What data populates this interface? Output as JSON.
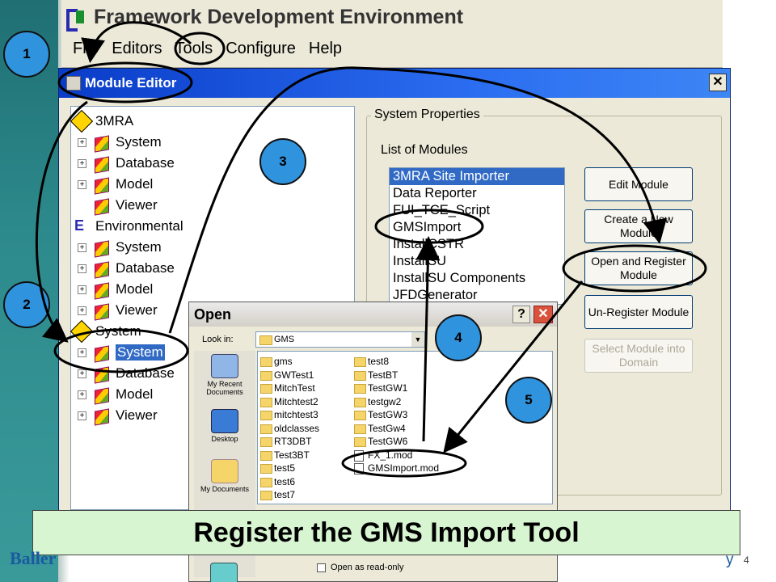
{
  "app": {
    "title": "Framework Development Environment",
    "menus": [
      "File",
      "Editors",
      "Tools",
      "Configure",
      "Help"
    ]
  },
  "module_editor": {
    "title": "Module Editor",
    "close_glyph": "✕",
    "tree": [
      {
        "label": "3MRA",
        "level": 0,
        "icon": "warning-cube-icon"
      },
      {
        "label": "System",
        "level": 1,
        "icon": "cube-icon"
      },
      {
        "label": "Database",
        "level": 1,
        "icon": "cube-icon"
      },
      {
        "label": "Model",
        "level": 1,
        "icon": "cube-icon"
      },
      {
        "label": "Viewer",
        "level": 1,
        "icon": "cube-icon",
        "leaf": true
      },
      {
        "label": "Environmental",
        "level": 0,
        "icon": "e-logo-icon"
      },
      {
        "label": "System",
        "level": 1,
        "icon": "cube-icon"
      },
      {
        "label": "Database",
        "level": 1,
        "icon": "cube-icon"
      },
      {
        "label": "Model",
        "level": 1,
        "icon": "cube-icon"
      },
      {
        "label": "Viewer",
        "level": 1,
        "icon": "cube-icon"
      },
      {
        "label": "System",
        "level": 0,
        "icon": "warning-cube-icon"
      },
      {
        "label": "System",
        "level": 1,
        "icon": "cube-icon",
        "selected": true
      },
      {
        "label": "Database",
        "level": 1,
        "icon": "cube-icon"
      },
      {
        "label": "Model",
        "level": 1,
        "icon": "cube-icon"
      },
      {
        "label": "Viewer",
        "level": 1,
        "icon": "cube-icon"
      }
    ],
    "system_properties": {
      "label": "System Properties",
      "list_label": "List of Modules",
      "modules": [
        "3MRA Site Importer",
        "Data Reporter",
        "FUI_TCE_Script",
        "GMSImport",
        "InstallCSTR",
        "InstallSU",
        "InstallSU Components",
        "JFDGenerator"
      ],
      "selected_index": 0
    },
    "buttons": {
      "edit": "Edit Module",
      "create": "Create a New Module",
      "open_register": "Open and Register Module",
      "unregister": "Un-Register Module",
      "select_into_domain": "Select Module into Domain"
    }
  },
  "open_dialog": {
    "title": "Open",
    "help_glyph": "?",
    "close_glyph": "✕",
    "look_in_label": "Look in:",
    "look_in_value": "GMS",
    "places": [
      "My Recent Documents",
      "Desktop",
      "My Documents"
    ],
    "files_col1": [
      "gms",
      "GWTest1",
      "MitchTest",
      "Mitchtest2",
      "mitchtest3",
      "oldclasses",
      "RT3DBT",
      "Test3BT",
      "test5",
      "test6",
      "test7"
    ],
    "files_col2": [
      "test8",
      "TestBT",
      "TestGW1",
      "testgw2",
      "TestGW3",
      "TestGw4",
      "TestGW6",
      "FX_1.mod",
      "GMSImport.mod"
    ],
    "readonly_label": "Open as read-only"
  },
  "callouts": [
    "1",
    "2",
    "3",
    "4",
    "5"
  ],
  "caption": "Register the GMS Import Tool",
  "footer": {
    "brand": "Baller",
    "tail": "y",
    "page": "4"
  },
  "colors": {
    "selection": "#316ac5",
    "titlebar": "#0a3cc8",
    "callout": "#2f93dd",
    "caption_bg": "#d7f5d0"
  }
}
